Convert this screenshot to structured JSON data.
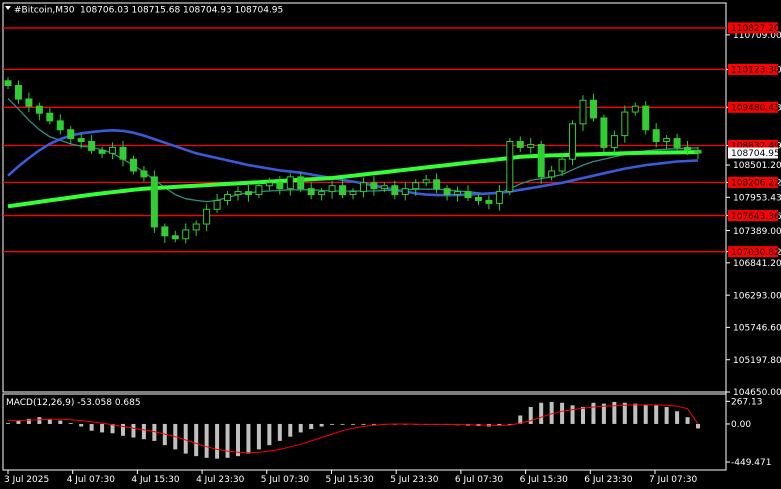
{
  "header": {
    "symbol": "#Bitcoin,M30",
    "ohlc": "108706.03 108715.68 108704.93 108704.95",
    "icon": "triangle-down-icon"
  },
  "colors": {
    "background": "#000000",
    "grid": "#ffffff",
    "candles": "#32cd32",
    "level_line": "#ff0000",
    "level_label_bg": "#ff0000",
    "price_label_bg": "#ffffff",
    "ma_fast": "#2f8f86",
    "ma_mid": "#3a5bd9",
    "ma_slow": "#33ff33",
    "macd_hist": "#c0c0c0",
    "macd_signal": "#ff0000",
    "axis_text": "#ffffff"
  },
  "chart_data": [
    {
      "type": "candlestick",
      "title": "#Bitcoin,M30",
      "grid": false,
      "y_ticks": [
        110709.0,
        110123.3,
        109480.43,
        108832.49,
        108501.2,
        108206.22,
        107953.43,
        107643.36,
        107389.0,
        107030.82,
        106841.2,
        106293.0,
        105746.6,
        105197.8,
        104650.0
      ],
      "ylim": [
        104650.0,
        111250.0
      ],
      "x_ticks": [
        "3 Jul 2025",
        "4 Jul 07:30",
        "4 Jul 15:30",
        "4 Jul 23:30",
        "5 Jul 07:30",
        "5 Jul 15:30",
        "5 Jul 23:30",
        "6 Jul 07:30",
        "6 Jul 15:30",
        "6 Jul 23:30",
        "7 Jul 07:30"
      ],
      "current_price": "108704.95",
      "levels": [
        {
          "label": "110827.20",
          "value": 110827.2
        },
        {
          "label": "110123.30",
          "value": 110123.3
        },
        {
          "label": "109480.43",
          "value": 109480.43
        },
        {
          "label": "108832.49",
          "value": 108832.49
        },
        {
          "label": "108206.22",
          "value": 108206.22
        },
        {
          "label": "107643.36",
          "value": 107643.36
        },
        {
          "label": "107030.82",
          "value": 107030.82
        }
      ],
      "close": [
        109850,
        109620,
        109500,
        109380,
        109250,
        109100,
        108950,
        108900,
        108750,
        108700,
        108800,
        108600,
        108400,
        108300,
        107450,
        107300,
        107250,
        107400,
        107500,
        107750,
        107900,
        108000,
        108050,
        108000,
        108150,
        108200,
        108100,
        108300,
        108100,
        108000,
        108050,
        108150,
        108000,
        108050,
        108200,
        108100,
        108150,
        108000,
        108100,
        108200,
        108250,
        108100,
        108000,
        108050,
        107950,
        107900,
        107850,
        108050,
        108900,
        108800,
        108850,
        108300,
        108400,
        108600,
        109200,
        109600,
        109300,
        108800,
        109000,
        109400,
        109500,
        109100,
        108900,
        108950,
        108800,
        108750,
        108704.95
      ],
      "series": [
        {
          "values": [
            109630,
            109450,
            109260,
            109100,
            108980,
            108920,
            108860,
            108820,
            108800,
            108760,
            108700,
            108600,
            108500,
            108380,
            108250,
            108120,
            108000,
            107930,
            107900,
            107880,
            107900,
            107950,
            108000,
            108030,
            108050,
            108060,
            108070,
            108080,
            108080,
            108080,
            108070,
            108060,
            108060,
            108060,
            108060,
            108060,
            108070,
            108070,
            108080,
            108090,
            108090,
            108090,
            108080,
            108060,
            108050,
            108030,
            108010,
            108020,
            108100,
            108180,
            108240,
            108270,
            108300,
            108340,
            108420,
            108500,
            108560,
            108600,
            108640,
            108680,
            108710,
            108740,
            108760,
            108770,
            108780,
            108790,
            108790
          ]
        },
        {
          "values": [
            108320,
            108480,
            108620,
            108750,
            108860,
            108940,
            109000,
            109040,
            109060,
            109080,
            109090,
            109080,
            109050,
            109000,
            108940,
            108880,
            108820,
            108760,
            108700,
            108660,
            108620,
            108580,
            108540,
            108500,
            108470,
            108440,
            108410,
            108390,
            108370,
            108340,
            108310,
            108280,
            108250,
            108220,
            108190,
            108150,
            108120,
            108080,
            108050,
            108020,
            108000,
            107990,
            107990,
            107990,
            108000,
            108010,
            108020,
            108030,
            108050,
            108080,
            108110,
            108140,
            108170,
            108200,
            108240,
            108280,
            108320,
            108360,
            108400,
            108440,
            108470,
            108500,
            108520,
            108540,
            108560,
            108570,
            108580
          ]
        },
        {
          "values": [
            107800,
            107825,
            107850,
            107875,
            107900,
            107925,
            107950,
            107975,
            108000,
            108020,
            108040,
            108060,
            108080,
            108100,
            108110,
            108120,
            108130,
            108140,
            108150,
            108160,
            108170,
            108180,
            108190,
            108200,
            108210,
            108220,
            108230,
            108240,
            108250,
            108260,
            108270,
            108280,
            108300,
            108320,
            108340,
            108360,
            108380,
            108400,
            108420,
            108440,
            108460,
            108480,
            108500,
            108520,
            108540,
            108560,
            108580,
            108600,
            108620,
            108640,
            108650,
            108660,
            108665,
            108670,
            108675,
            108680,
            108685,
            108690,
            108695,
            108700,
            108705,
            108710,
            108712,
            108714,
            108716,
            108718,
            108720
          ]
        }
      ]
    },
    {
      "type": "bar",
      "title": "MACD(12,26,9) -53.058 0.685",
      "grid": false,
      "y_ticks": [
        267.13,
        0.0,
        -449.471
      ],
      "ylim": [
        -520,
        330
      ],
      "values": [
        10,
        40,
        60,
        80,
        60,
        40,
        10,
        -30,
        -80,
        -100,
        -110,
        -140,
        -160,
        -180,
        -200,
        -250,
        -300,
        -350,
        -380,
        -400,
        -410,
        -400,
        -380,
        -350,
        -300,
        -250,
        -200,
        -150,
        -100,
        -60,
        -30,
        -10,
        0,
        -5,
        -10,
        -5,
        0,
        0,
        -5,
        -10,
        -10,
        -5,
        -10,
        -15,
        -20,
        -25,
        -30,
        -20,
        0,
        100,
        200,
        250,
        260,
        250,
        220,
        200,
        250,
        240,
        260,
        250,
        240,
        230,
        220,
        200,
        150,
        80,
        -53.058
      ],
      "signal": [
        40,
        40,
        45,
        50,
        55,
        55,
        50,
        40,
        25,
        10,
        -10,
        -30,
        -50,
        -70,
        -90,
        -120,
        -150,
        -190,
        -230,
        -270,
        -300,
        -320,
        -335,
        -340,
        -335,
        -320,
        -300,
        -270,
        -240,
        -200,
        -160,
        -120,
        -80,
        -50,
        -30,
        -15,
        -5,
        0,
        0,
        -3,
        -5,
        -5,
        -5,
        -7,
        -10,
        -12,
        -15,
        -17,
        -13,
        10,
        40,
        80,
        120,
        150,
        170,
        185,
        200,
        210,
        215,
        220,
        225,
        225,
        225,
        220,
        210,
        180,
        0.685
      ]
    }
  ]
}
